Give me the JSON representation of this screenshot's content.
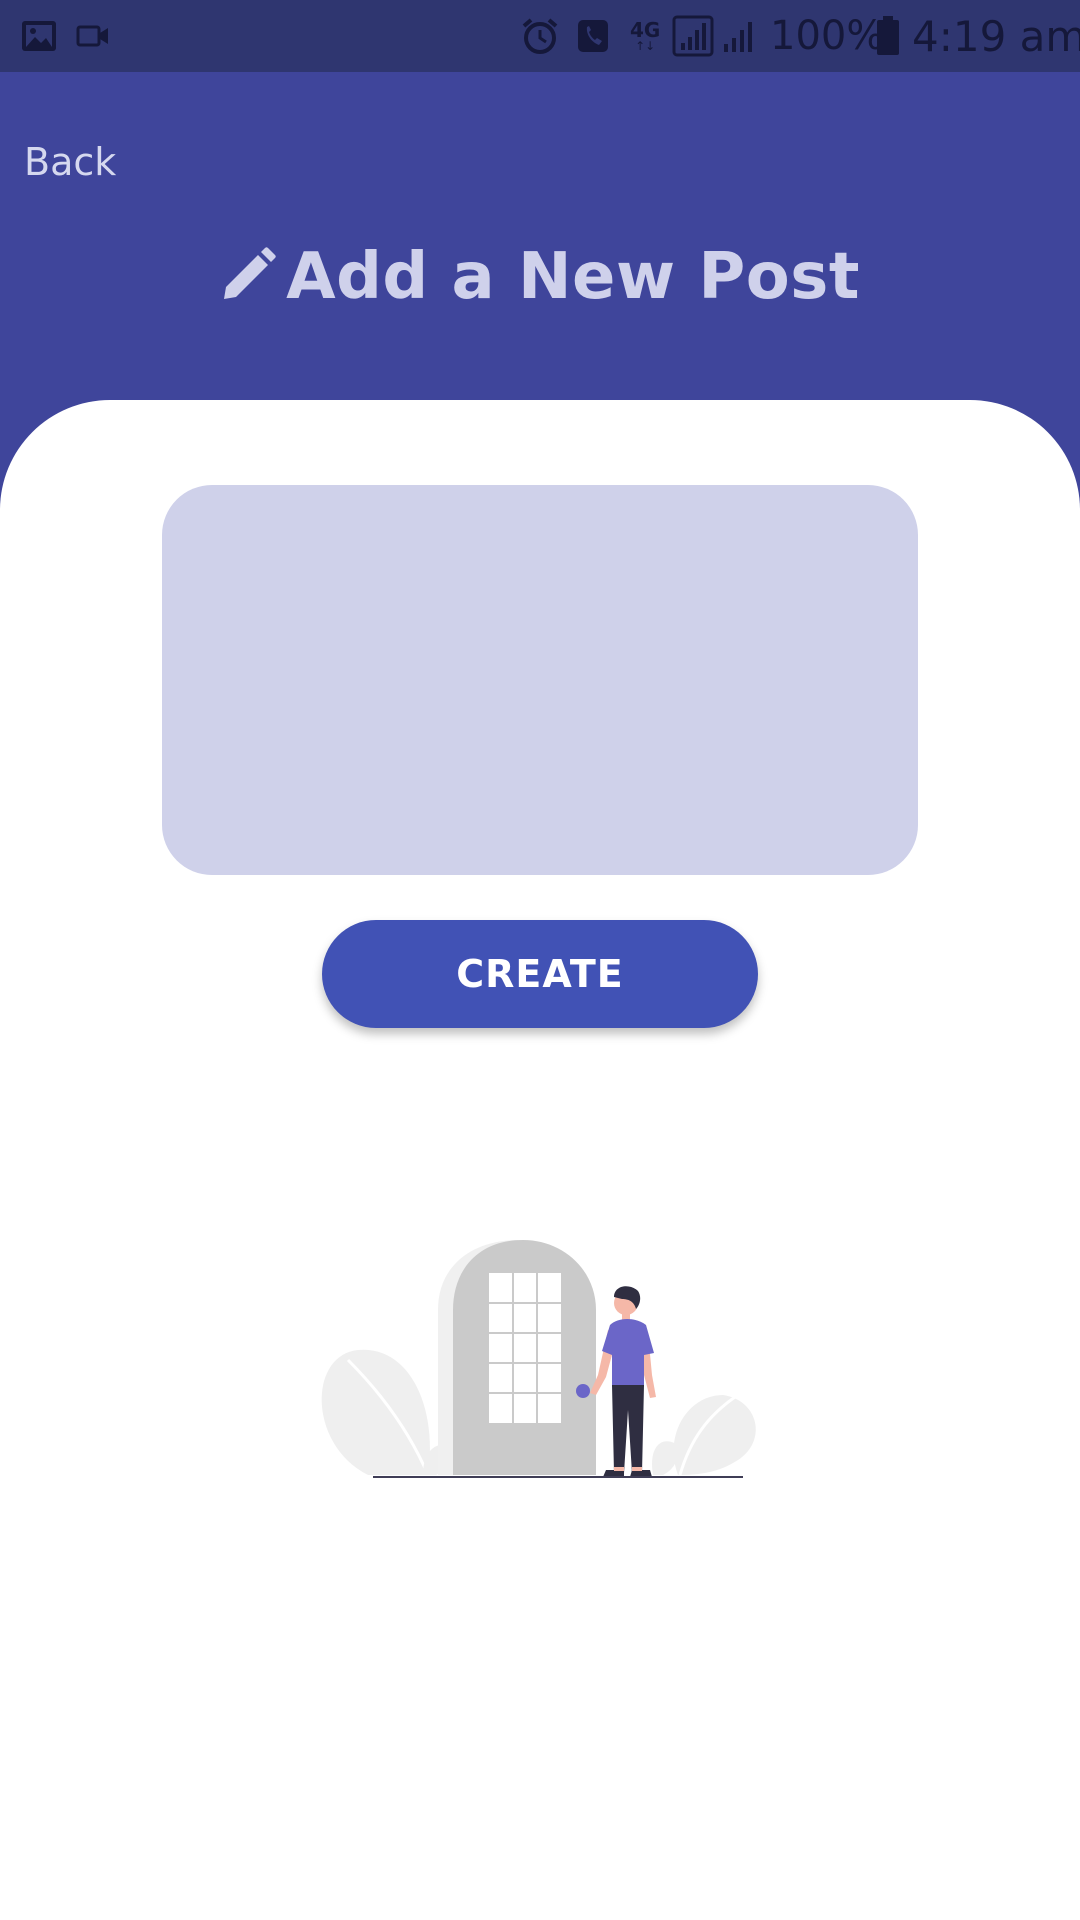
{
  "status_bar": {
    "battery_percent": "100%",
    "time": "4:19 am",
    "network": "4G",
    "icons": [
      "image-icon",
      "video-camera-icon",
      "alarm-icon",
      "phone-icon",
      "signal-4g-icon",
      "signal-bars-icon",
      "signal-bars-2-icon",
      "battery-icon"
    ]
  },
  "header": {
    "back_label": "Back",
    "title": "Add a New Post",
    "title_icon": "pencil-icon"
  },
  "form": {
    "post_value": "",
    "post_placeholder": "",
    "create_label": "CREATE"
  },
  "illustration": {
    "name": "person-at-door-illustration"
  },
  "colors": {
    "status_bar": "#2f3670",
    "header": "#3f459b",
    "title": "#cfd1eb",
    "input_bg": "#cfd1ea",
    "button": "#4152b5",
    "button_text": "#ffffff"
  }
}
